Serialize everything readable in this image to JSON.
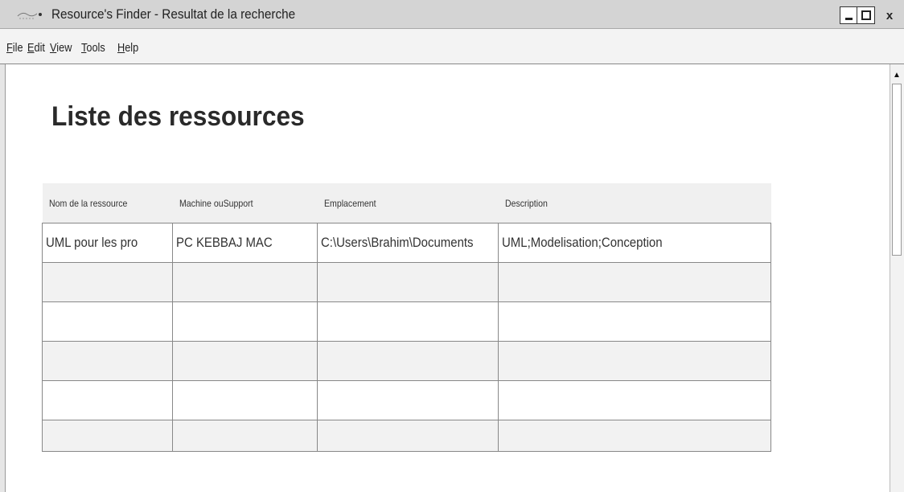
{
  "window": {
    "title": "Resource's Finder - Resultat de la recherche",
    "close_label": "x"
  },
  "menu": [
    {
      "mnemonic": "F",
      "rest": "ile"
    },
    {
      "mnemonic": "E",
      "rest": "dit"
    },
    {
      "mnemonic": "V",
      "rest": "iew"
    },
    {
      "mnemonic": "T",
      "rest": "ools"
    },
    {
      "mnemonic": "H",
      "rest": "elp"
    }
  ],
  "page": {
    "title": "Liste des ressources"
  },
  "table": {
    "columns": [
      "Nom de la ressource",
      "Machine ouSupport",
      "Emplacement",
      "Description"
    ],
    "rows": [
      [
        "UML pour les pro",
        "PC KEBBAJ MAC",
        "C:\\Users\\Brahim\\Documents",
        "UML;Modelisation;Conception"
      ],
      [
        "",
        "",
        "",
        ""
      ],
      [
        "",
        "",
        "",
        ""
      ],
      [
        "",
        "",
        "",
        ""
      ],
      [
        "",
        "",
        "",
        ""
      ],
      [
        "",
        "",
        "",
        ""
      ]
    ]
  },
  "icons": {
    "app": "app-logo-icon",
    "minimize": "minimize-icon",
    "maximize": "maximize-icon",
    "scroll_up": "scroll-up-arrow-icon"
  }
}
